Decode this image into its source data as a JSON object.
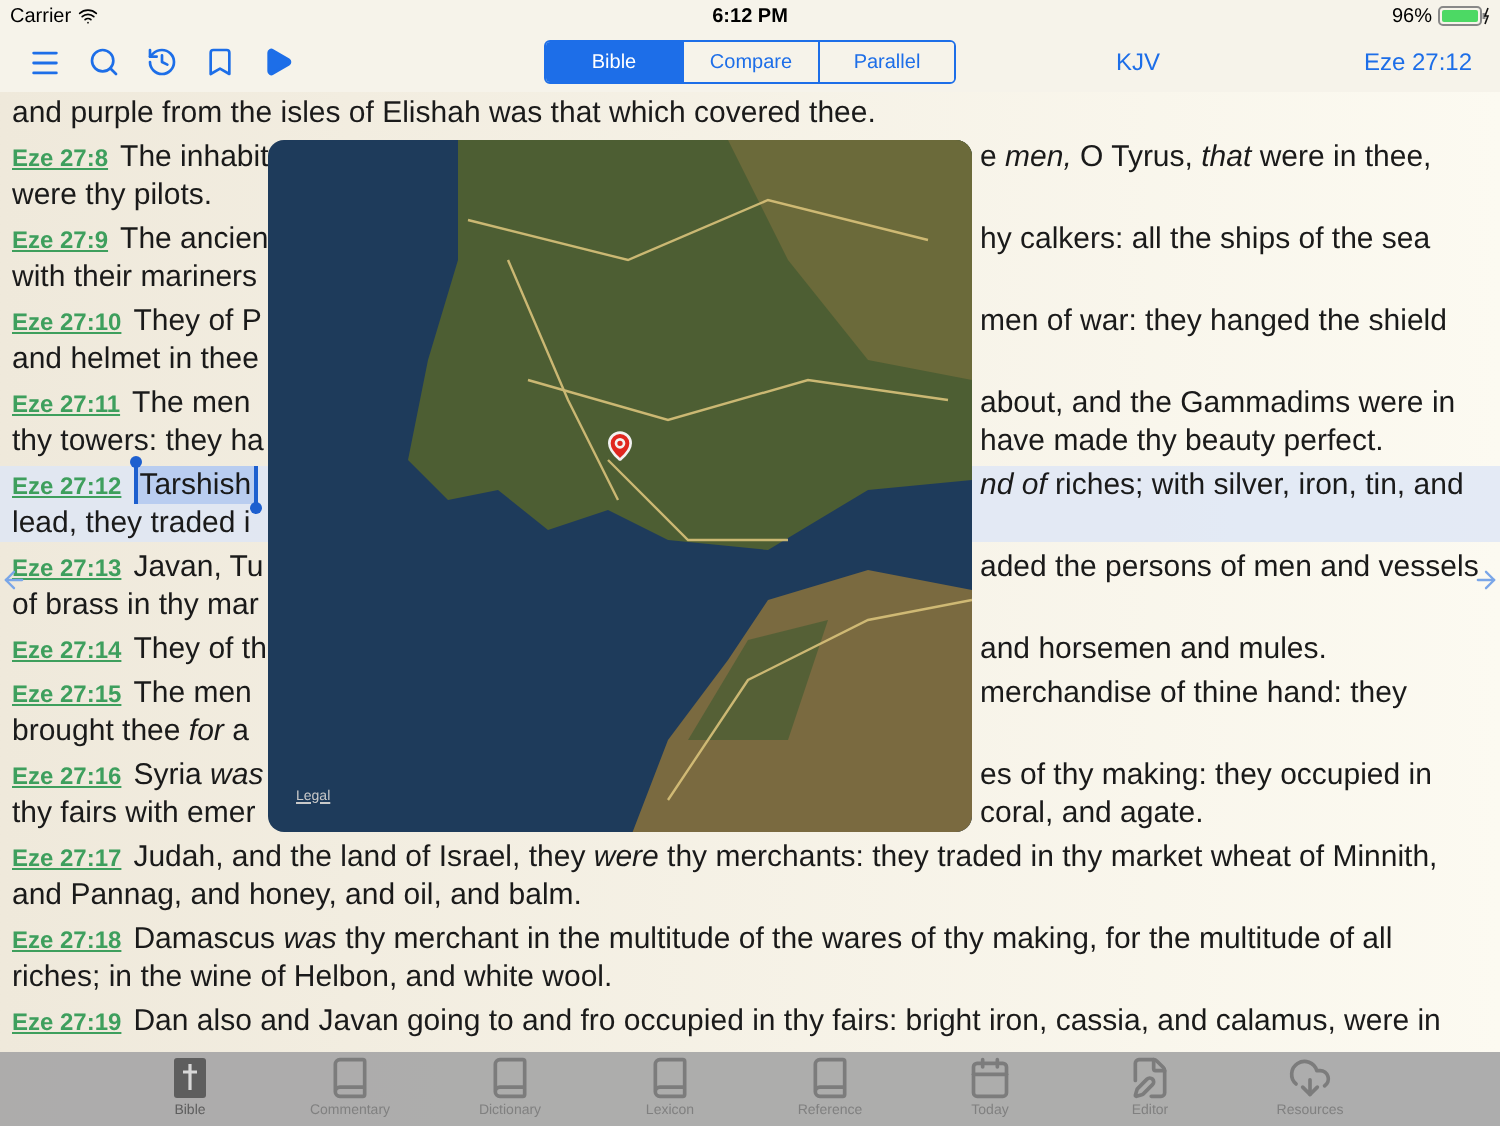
{
  "status_bar": {
    "carrier": "Carrier",
    "time": "6:12 PM",
    "battery": "96%"
  },
  "toolbar": {
    "modes": [
      {
        "label": "Bible",
        "selected": true
      },
      {
        "label": "Compare",
        "selected": false
      },
      {
        "label": "Parallel",
        "selected": false
      }
    ],
    "version": "KJV",
    "reference": "Eze 27:12"
  },
  "verses": [
    {
      "lines": [
        {
          "text": "and purple from the isles of Elishah was that which covered thee."
        }
      ],
      "selected": false
    },
    {
      "ref": "Eze 27:8",
      "selected": false,
      "lines": [
        {
          "text": "The inhabit",
          "right": "e *men,* O Tyrus, *that* were in thee,"
        },
        {
          "text": "were thy pilots."
        }
      ]
    },
    {
      "ref": "Eze 27:9",
      "selected": false,
      "lines": [
        {
          "text": "The ancien",
          "right": "hy calkers: all the ships of the sea"
        },
        {
          "text": "with their mariners"
        }
      ]
    },
    {
      "ref": "Eze 27:10",
      "selected": false,
      "lines": [
        {
          "text": "They of P",
          "right": "men of war: they hanged the shield"
        },
        {
          "text": "and helmet in thee"
        }
      ]
    },
    {
      "ref": "Eze 27:11",
      "selected": false,
      "lines": [
        {
          "text": "The men",
          "right": "about, and the Gammadims were in"
        },
        {
          "text": "thy towers: they ha",
          "right": "have made thy beauty perfect."
        }
      ]
    },
    {
      "ref": "Eze 27:12",
      "selected": true,
      "lines": [
        {
          "text": "Tarshish",
          "word_selected": true,
          "right": "*nd of* riches; with silver, iron, tin, and"
        },
        {
          "text": "lead, they traded i"
        }
      ]
    },
    {
      "ref": "Eze 27:13",
      "selected": false,
      "lines": [
        {
          "text": "Javan, Tu",
          "right": "aded the persons of men and vessels"
        },
        {
          "text": "of brass in thy mar"
        }
      ]
    },
    {
      "ref": "Eze 27:14",
      "selected": false,
      "lines": [
        {
          "text": "They of th",
          "right": "and horsemen and mules."
        }
      ]
    },
    {
      "ref": "Eze 27:15",
      "selected": false,
      "lines": [
        {
          "text": "The men",
          "right": "merchandise of thine hand: they"
        },
        {
          "text": "brought thee *for* a"
        }
      ]
    },
    {
      "ref": "Eze 27:16",
      "selected": false,
      "lines": [
        {
          "text": "Syria *was*",
          "right": "es of thy making: they occupied in"
        },
        {
          "text": "thy fairs with emer",
          "right": "coral, and agate."
        }
      ]
    },
    {
      "ref": "Eze 27:17",
      "selected": false,
      "lines": [
        {
          "text": "Judah, and the land of Israel, they *were* thy merchants: they traded in thy market wheat of Minnith,"
        },
        {
          "text": "and Pannag, and honey, and oil, and balm."
        }
      ]
    },
    {
      "ref": "Eze 27:18",
      "selected": false,
      "lines": [
        {
          "text": "Damascus *was* thy merchant in the multitude of the wares of thy making, for the multitude of all"
        },
        {
          "text": "riches; in the wine of Helbon, and white wool."
        }
      ]
    },
    {
      "ref": "Eze 27:19",
      "selected": false,
      "lines": [
        {
          "text": "Dan also and Javan going to and fro occupied in thy fairs: bright iron, cassia, and calamus, were in"
        }
      ]
    }
  ],
  "map": {
    "legal": "Legal"
  },
  "tab_bar": [
    {
      "label": "Bible",
      "kind": "bible",
      "selected": true
    },
    {
      "label": "Commentary",
      "kind": "book",
      "selected": false
    },
    {
      "label": "Dictionary",
      "kind": "book",
      "selected": false
    },
    {
      "label": "Lexicon",
      "kind": "book",
      "selected": false
    },
    {
      "label": "Reference",
      "kind": "book",
      "selected": false
    },
    {
      "label": "Today",
      "kind": "calendar",
      "selected": false
    },
    {
      "label": "Editor",
      "kind": "editor",
      "selected": false
    },
    {
      "label": "Resources",
      "kind": "cloud",
      "selected": false
    }
  ]
}
